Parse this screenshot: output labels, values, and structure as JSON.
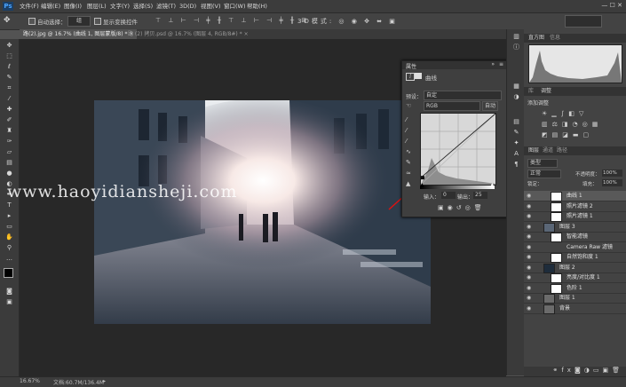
{
  "app": {
    "logo": "Ps"
  },
  "menu": [
    "文件(F)",
    "编辑(E)",
    "图像(I)",
    "图层(L)",
    "文字(Y)",
    "选择(S)",
    "滤镜(T)",
    "3D(D)",
    "视图(V)",
    "窗口(W)",
    "帮助(H)"
  ],
  "window_controls": "—  ☐  ✕",
  "options": {
    "auto_select_label": "自动选择：",
    "auto_select_value": "组",
    "show_transform_label": "显示变换控件"
  },
  "tabs": [
    {
      "label": "路(2).jpg @ 16.7% (曲线 1, 图层蒙版/8) * ×"
    },
    {
      "label": "路 (2) 拷贝.psd @ 16.7% (图层 4, RGB/8#) * ×"
    }
  ],
  "watermark": "www.haoyidiansheji.com",
  "status": {
    "zoom": "16.67%",
    "doc": "文档:60.7M/136.4M"
  },
  "properties": {
    "tab_label": "属性",
    "title": "曲线",
    "preset_label": "预设：",
    "preset_value": "自定",
    "channel_value": "RGB",
    "auto_label": "自动",
    "input_label": "输入：",
    "input_value": "0",
    "output_label": "输出：",
    "output_value": "25",
    "curve_point": {
      "input": 0,
      "output": 25
    }
  },
  "histogram_panel": {
    "tabs": [
      "直方图",
      "信息"
    ]
  },
  "adjustments_panel": {
    "tabs": [
      "库",
      "调整"
    ],
    "add_label": "添加调整"
  },
  "layers_panel": {
    "tabs": [
      "图层",
      "通道",
      "路径"
    ],
    "kind_label": "类型",
    "blend_mode": "正常",
    "opacity_label": "不透明度：",
    "opacity_value": "100%",
    "lock_label": "锁定：",
    "fill_label": "填充：",
    "fill_value": "100%",
    "layers": [
      {
        "name": "曲线 1",
        "thumb": "#ffffff"
      },
      {
        "name": "照片滤镜 2",
        "thumb": "#ffffff"
      },
      {
        "name": "照片滤镜 1",
        "thumb": "#ffffff"
      },
      {
        "name": "图层 3",
        "thumb": "#5a6676"
      },
      {
        "name": "智能滤镜",
        "thumb": "#ffffff"
      },
      {
        "name": "Camera Raw 滤镜",
        "thumb": ""
      },
      {
        "name": "自然饱和度 1",
        "thumb": "#ffffff"
      },
      {
        "name": "图层 2",
        "thumb": "#1e2c3b"
      },
      {
        "name": "亮度/对比度 1",
        "thumb": "#ffffff"
      },
      {
        "name": "色阶 1",
        "thumb": "#ffffff"
      },
      {
        "name": "图层 1",
        "thumb": "#6b6b6b"
      },
      {
        "name": "背景",
        "thumb": "#6b6b6b"
      }
    ]
  }
}
